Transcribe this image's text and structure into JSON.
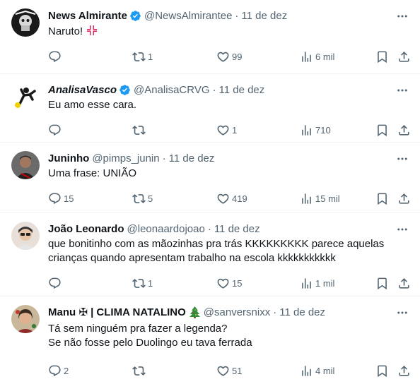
{
  "tweets": [
    {
      "name": "News Almirante",
      "handle": "@NewsAlmirantee",
      "separator": "·",
      "time": "11 de dez",
      "text": "Naruto!",
      "emoji": "anger-symbol-icon",
      "verified": true,
      "replies": "",
      "retweets": "1",
      "likes": "99",
      "views": "6 mil"
    },
    {
      "name": "AnalisaVasco",
      "handle": "@AnalisaCRVG",
      "separator": "·",
      "time": "11 de dez",
      "text": "Eu amo esse cara.",
      "verified": true,
      "replies": "",
      "retweets": "",
      "likes": "1",
      "views": "710"
    },
    {
      "name": "Juninho",
      "handle": "@pimps_junin",
      "separator": "·",
      "time": "11 de dez",
      "text": "Uma frase: UNIÃO",
      "verified": false,
      "replies": "15",
      "retweets": "5",
      "likes": "419",
      "views": "15 mil"
    },
    {
      "name": "João Leonardo",
      "handle": "@leonaardojoao",
      "separator": "·",
      "time": "11 de dez",
      "text_lines": [
        "que bonitinho com as mãozinhas pra trás KKKKKKKKK parece aquelas",
        "crianças quando apresentam trabalho na escola kkkkkkkkkkk"
      ],
      "verified": false,
      "replies": "",
      "retweets": "1",
      "likes": "15",
      "views": "1 mil"
    },
    {
      "name": "Manu ✠ | CLIMA NATALINO",
      "name_emoji": "christmas-tree-icon",
      "handle": "@sanversnixx",
      "separator": "·",
      "time": "11 de dez",
      "text_lines": [
        "Tá sem ninguém pra fazer a legenda?",
        "Se não fosse pelo Duolingo eu tava ferrada"
      ],
      "verified": false,
      "replies": "2",
      "retweets": "",
      "likes": "51",
      "views": "4 mil"
    }
  ],
  "colors": {
    "text": "#0f1419",
    "secondary": "#536471",
    "verified": "#1d9bf0",
    "divider": "#eff3f4"
  }
}
